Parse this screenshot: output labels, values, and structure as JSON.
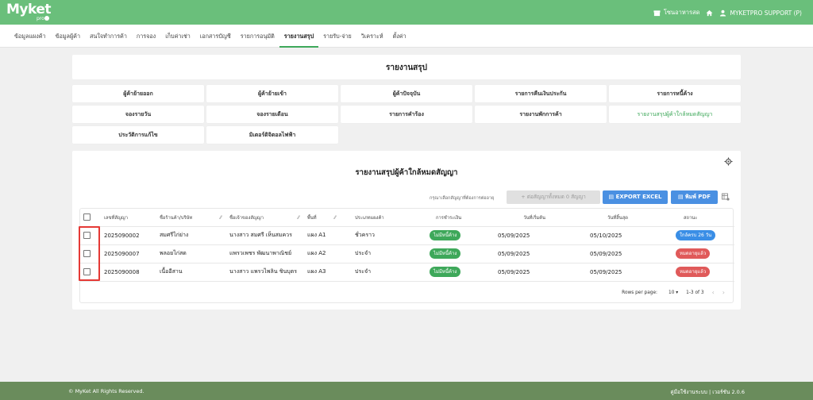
{
  "app": {
    "logo_text": "Myket",
    "logo_sub": "pro"
  },
  "topbar": {
    "store_label": "โซนอาหารสด",
    "user_label": "MYKETPRO SUPPORT (P)"
  },
  "nav": {
    "tabs": [
      {
        "label": "ข้อมูลแผงค้า",
        "active": false
      },
      {
        "label": "ข้อมูลผู้ค้า",
        "active": false
      },
      {
        "label": "สนใจทำการค้า",
        "active": false
      },
      {
        "label": "การจอง",
        "active": false
      },
      {
        "label": "เก็บค่าเช่า",
        "active": false
      },
      {
        "label": "เอกสารบัญชี",
        "active": false
      },
      {
        "label": "รายการอนุมัติ",
        "active": false
      },
      {
        "label": "รายงานสรุป",
        "active": true
      },
      {
        "label": "รายรับ-จ่าย",
        "active": false
      },
      {
        "label": "วิเคราะห์",
        "active": false
      },
      {
        "label": "ตั้งค่า",
        "active": false
      }
    ]
  },
  "report": {
    "title": "รายงานสรุป",
    "buttons": [
      {
        "label": "ผู้ค้าย้ายออก",
        "active": false
      },
      {
        "label": "ผู้ค้าย้ายเข้า",
        "active": false
      },
      {
        "label": "ผู้ค้าปัจจุบัน",
        "active": false
      },
      {
        "label": "รายการคืนเงินประกัน",
        "active": false
      },
      {
        "label": "รายการหนี้ค้าง",
        "active": false
      },
      {
        "label": "จองรายวัน",
        "active": false
      },
      {
        "label": "จองรายเดือน",
        "active": false
      },
      {
        "label": "รายการคำร้อง",
        "active": false
      },
      {
        "label": "รายงานพักการค้า",
        "active": false
      },
      {
        "label": "รายงานสรุปผู้ค้าใกล้หมดสัญญา",
        "active": true
      },
      {
        "label": "ประวัติการแก้ไข",
        "active": false
      },
      {
        "label": "มิเตอร์ดิจิตอลไฟฟ้า",
        "active": false
      }
    ]
  },
  "table_section": {
    "title": "รายงานสรุปผู้ค้าใกล้หมดสัญญา",
    "hint": "กรุณาเลือกสัญญาที่ต้องการต่ออายุ",
    "extend_button": "+ ต่อสัญญาทั้งหมด 0 สัญญา",
    "excel_button": "EXPORT EXCEL",
    "print_button": "พิมพ์ PDF",
    "columns": [
      "เลขที่สัญญา",
      "ชื่อร้านค้า/บริษัท",
      "ชื่อเจ้าของสัญญา",
      "พื้นที่",
      "ประเภทแผงค้า",
      "การชำระเงิน",
      "วันที่เริ่มต้น",
      "วันที่สิ้นสุด",
      "สถานะ"
    ],
    "rows": [
      {
        "contract": "2025090002",
        "shop": "สมศรีไก่ย่าง",
        "owner": "นางสาว สมศรี เห็นสมควร",
        "area": "แผง A1",
        "type": "ชั่วคราว",
        "payment": "ไม่มีหนี้ค้าง",
        "start": "05/09/2025",
        "end": "05/10/2025",
        "status": "ใกล้ครบ 26 วัน",
        "status_color": "blue"
      },
      {
        "contract": "2025090007",
        "shop": "พลอยไก่สด",
        "owner": "แพรวเพชร พัฒนาพาณิชย์",
        "area": "แผง A2",
        "type": "ประจำ",
        "payment": "ไม่มีหนี้ค้าง",
        "start": "05/09/2025",
        "end": "05/09/2025",
        "status": "หมดอายุแล้ว",
        "status_color": "red"
      },
      {
        "contract": "2025090008",
        "shop": "เนื้ออีสาน",
        "owner": "นางสาว แพรวไพลิน ชินบุตร",
        "area": "แผง A3",
        "type": "ประจำ",
        "payment": "ไม่มีหนี้ค้าง",
        "start": "05/09/2025",
        "end": "05/09/2025",
        "status": "หมดอายุแล้ว",
        "status_color": "red"
      }
    ],
    "pagination": {
      "rows_per_page_label": "Rows per page:",
      "rows_per_page": "10",
      "range": "1-3 of 3"
    }
  },
  "footer": {
    "left": "© MyKet All Rights Reserved.",
    "right": "คู่มือใช้งานระบบ | เวอร์ชัน 2.0.6"
  },
  "colors": {
    "primary_green": "#6abf7b",
    "button_blue": "#4a90e2",
    "pill_green": "#3ea85a",
    "pill_blue": "#3a8ee6",
    "pill_red": "#e05a5a",
    "highlight_red": "#e53935"
  },
  "icons": [
    "store-icon",
    "home-icon",
    "user-icon",
    "settings-icon",
    "document-icon",
    "print-icon",
    "column-settings-icon",
    "chevron-down-icon",
    "chevron-left-icon",
    "chevron-right-icon"
  ]
}
